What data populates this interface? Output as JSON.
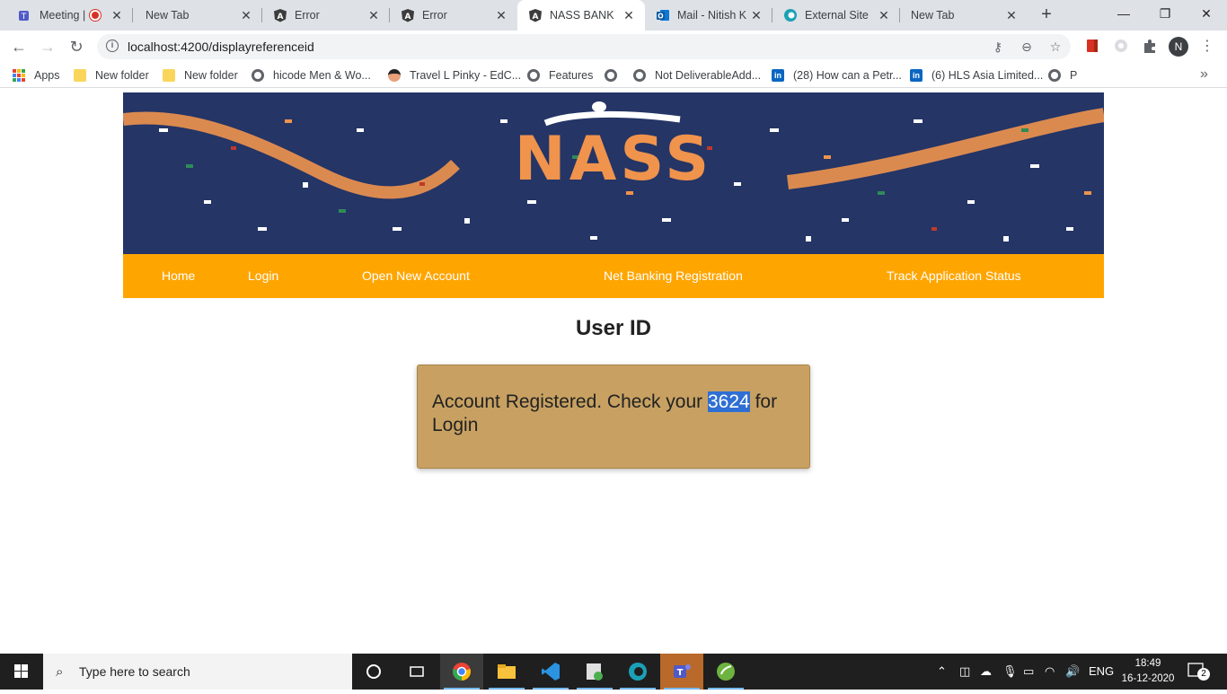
{
  "browser": {
    "tabs": [
      {
        "title": "Meeting |",
        "icon": "teams-icon",
        "active": false
      },
      {
        "title": "New Tab",
        "icon": "",
        "active": false
      },
      {
        "title": "Error",
        "icon": "angular-icon",
        "active": false
      },
      {
        "title": "Error",
        "icon": "angular-icon",
        "active": false
      },
      {
        "title": "NASS BANK",
        "icon": "angular-icon",
        "active": true
      },
      {
        "title": "Mail - Nitish K",
        "icon": "outlook-icon",
        "active": false
      },
      {
        "title": "External Site",
        "icon": "edge-icon",
        "active": false
      },
      {
        "title": "New Tab",
        "icon": "",
        "active": false
      }
    ],
    "url": "localhost:4200/displayreferenceid",
    "profile_initial": "N",
    "bookmarks": [
      {
        "label": "Apps",
        "icon": "apps-icon"
      },
      {
        "label": "New folder",
        "icon": "folder-icon"
      },
      {
        "label": "New folder",
        "icon": "folder-icon"
      },
      {
        "label": "hicode Men & Wo...",
        "icon": "globe-icon"
      },
      {
        "label": "Travel L Pinky - EdC...",
        "icon": "avatar-icon"
      },
      {
        "label": "Features",
        "icon": "globe-icon"
      },
      {
        "label": "",
        "icon": "globe-icon"
      },
      {
        "label": "Not DeliverableAdd...",
        "icon": "globe-icon"
      },
      {
        "label": "(28) How can a Petr...",
        "icon": "linkedin-icon"
      },
      {
        "label": "(6) HLS Asia Limited...",
        "icon": "linkedin-icon"
      },
      {
        "label": "P",
        "icon": "globe-icon"
      }
    ]
  },
  "page": {
    "banner_logo": "NASS",
    "nav": [
      "Home",
      "Login",
      "Open New Account",
      "Net Banking Registration",
      "Track Application Status"
    ],
    "heading": "User ID",
    "alert": {
      "prefix": "Account Registered. Check your",
      "highlight": "3624",
      "suffix": "for Login"
    }
  },
  "taskbar": {
    "search_placeholder": "Type here to search",
    "language": "ENG",
    "time": "18:49",
    "date": "16-12-2020",
    "notification_count": "2"
  },
  "colors": {
    "nav_bg": "#ffa500",
    "banner_bg": "#243566",
    "alert_bg": "#c8a162",
    "highlight": "#2f6fd3"
  }
}
